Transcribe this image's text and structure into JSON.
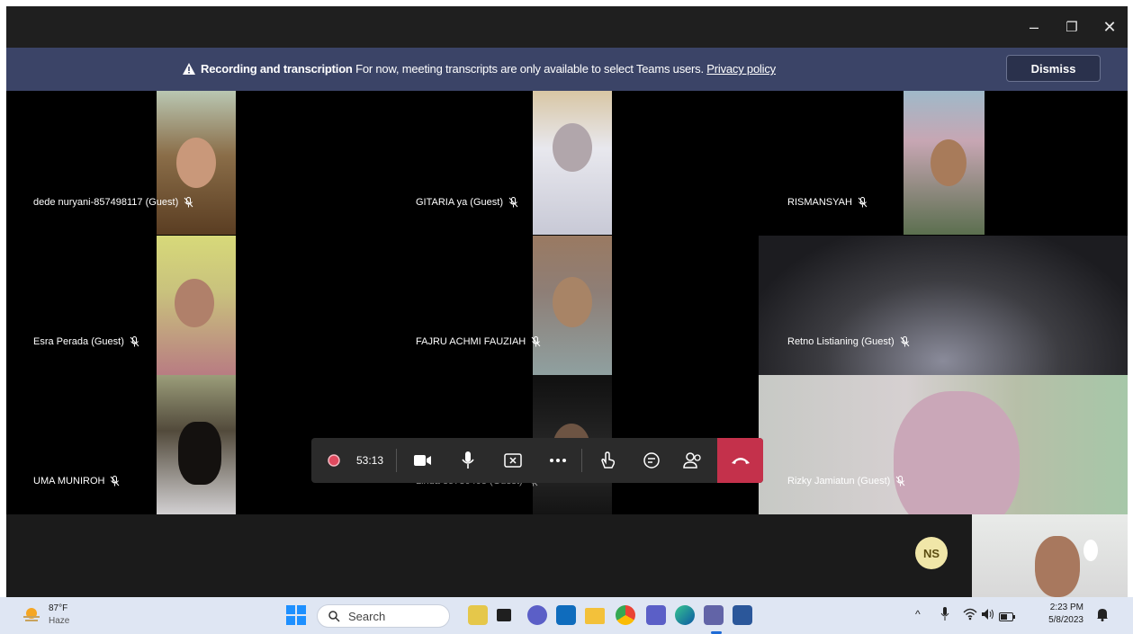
{
  "window": {
    "controls": [
      "–",
      "❐",
      "✕"
    ]
  },
  "banner": {
    "title": "Recording and transcription",
    "message": "For now, meeting transcripts are only available to select Teams users.",
    "link": "Privacy policy",
    "dismiss": "Dismiss"
  },
  "participants": [
    {
      "name": "dede nuryani-857498117 (Guest)"
    },
    {
      "name": "GITARIA ya (Guest)"
    },
    {
      "name": "RISMANSYAH"
    },
    {
      "name": "Esra Perada (Guest)"
    },
    {
      "name": "FAJRU ACHMI FAUZIAH"
    },
    {
      "name": "Retno Listianing (Guest)"
    },
    {
      "name": "UMA MUNIROH"
    },
    {
      "name": "Linda 85730408 (Guest)"
    },
    {
      "name": "Rizky Jamiatun (Guest)"
    }
  ],
  "toolbar": {
    "timer": "53:13"
  },
  "self": {
    "initials": "NS"
  },
  "taskbar": {
    "weather_temp": "87°F",
    "weather_desc": "Haze",
    "search_placeholder": "Search",
    "time": "2:23 PM",
    "date": "5/8/2023"
  },
  "colors": {
    "banner": "#3b4467",
    "hangup": "#c4314b",
    "record": "#e04a5f",
    "taskbar": "#dfe6f3"
  }
}
